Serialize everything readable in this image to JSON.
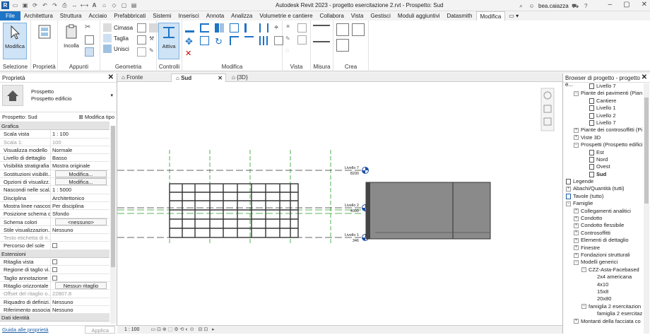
{
  "title_bar": {
    "title": "Autodesk Revit 2023 - progetto esercitazione 2.rvt - Prospetto: Sud",
    "user": "bea.caiazza"
  },
  "menu_tabs": [
    "File",
    "Architettura",
    "Struttura",
    "Acciaio",
    "Prefabbricati",
    "Sistemi",
    "Inserisci",
    "Annota",
    "Analizza",
    "Volumetrie e cantiere",
    "Collabora",
    "Vista",
    "Gestisci",
    "Moduli aggiuntivi",
    "Datasmith",
    "Modifica"
  ],
  "ribbon": {
    "modifica_label": "Modifica",
    "proprieta_label": "Proprietà",
    "incolla_label": "Incolla",
    "cimasa_label": "Cimasa",
    "taglia_label": "Taglia",
    "unisci_label": "Unisci",
    "attiva_label": "Attiva",
    "groups": {
      "selezione": "Selezione",
      "proprieta": "Proprietà",
      "appunti": "Appunti",
      "geometria": "Geometria",
      "controlli": "Controlli",
      "modifica": "Modifica",
      "vista": "Vista",
      "misura": "Misura",
      "crea": "Crea"
    }
  },
  "properties": {
    "panel_title": "Proprietà",
    "type_line1": "Prospetto",
    "type_line2": "Prospetto edificio",
    "instance_label": "Prospetto: Sud",
    "edit_type": "Modifica tipo",
    "sections": [
      {
        "name": "Grafica",
        "rows": [
          {
            "k": "Scala vista",
            "v": "1 : 100"
          },
          {
            "k": "Scala 1:",
            "v": "100",
            "grey": true
          },
          {
            "k": "Visualizza modello",
            "v": "Normale"
          },
          {
            "k": "Livello di dettaglio",
            "v": "Basso"
          },
          {
            "k": "Visibilità stratigrafia",
            "v": "Mostra originale"
          },
          {
            "k": "Sostituzioni visibilit...",
            "v": "Modifica...",
            "btn": true
          },
          {
            "k": "Opzioni di visualizz...",
            "v": "Modifica...",
            "btn": true
          },
          {
            "k": "Nascondi nelle scal...",
            "v": "1 : 5000"
          },
          {
            "k": "Disciplina",
            "v": "Architettonico"
          },
          {
            "k": "Mostra linee nascos...",
            "v": "Per disciplina"
          },
          {
            "k": "Posizione schema c...",
            "v": "Sfondo"
          },
          {
            "k": "Schema colori",
            "v": "<nessuno>",
            "btn": true
          },
          {
            "k": "Stile visualizzazion...",
            "v": "Nessuno"
          },
          {
            "k": "Testo etichetta di ri...",
            "v": "",
            "grey": true
          },
          {
            "k": "Percorso del sole",
            "v": "",
            "check": true
          }
        ]
      },
      {
        "name": "Estensioni",
        "rows": [
          {
            "k": "Ritaglia vista",
            "v": "",
            "check": true
          },
          {
            "k": "Regione di taglio vi...",
            "v": "",
            "check": true
          },
          {
            "k": "Taglio annotazione",
            "v": "",
            "check": true
          },
          {
            "k": "Ritaglio orizzontale",
            "v": "Nessun ritaglio",
            "btn": true
          },
          {
            "k": "Offset del ritaglio o...",
            "v": "22807.8",
            "grey": true
          },
          {
            "k": "Riquadro di definizi...",
            "v": "Nessuno"
          },
          {
            "k": "Riferimento associa...",
            "v": "Nessuno"
          }
        ]
      },
      {
        "name": "Dati identità",
        "rows": []
      }
    ],
    "help_link": "Guida alle proprietà",
    "apply": "Applica"
  },
  "view_tabs": [
    {
      "label": "Fronte",
      "active": false
    },
    {
      "label": "Sud",
      "active": true
    },
    {
      "label": "{3D}",
      "active": false
    }
  ],
  "levels": [
    {
      "name": "Livello 7",
      "elev": "8200"
    },
    {
      "name": "Livello 2",
      "elev": "4000"
    },
    {
      "name": "Livello 1",
      "elev": "346"
    }
  ],
  "status": {
    "scale": "1 : 100"
  },
  "browser": {
    "title": "Browser di progetto - progetto e...",
    "items": [
      {
        "label": "Livello 7",
        "indent": 3,
        "icon": "sheet"
      },
      {
        "label": "Piante dei pavimenti (Pian",
        "indent": 1,
        "icon": "minus"
      },
      {
        "label": "Cantiere",
        "indent": 3,
        "icon": "sheet"
      },
      {
        "label": "Livello 1",
        "indent": 3,
        "icon": "sheet"
      },
      {
        "label": "Livello 2",
        "indent": 3,
        "icon": "sheet"
      },
      {
        "label": "Livello 7",
        "indent": 3,
        "icon": "sheet"
      },
      {
        "label": "Piante dei controsoffitti (Pi",
        "indent": 1,
        "icon": "plus"
      },
      {
        "label": "Viste 3D",
        "indent": 1,
        "icon": "plus"
      },
      {
        "label": "Prospetti (Prospetto edifici",
        "indent": 1,
        "icon": "minus"
      },
      {
        "label": "Est",
        "indent": 3,
        "icon": "sheet"
      },
      {
        "label": "Nord",
        "indent": 3,
        "icon": "sheet"
      },
      {
        "label": "Ovest",
        "indent": 3,
        "icon": "sheet"
      },
      {
        "label": "Sud",
        "indent": 3,
        "icon": "sheet",
        "bold": true
      },
      {
        "label": "Legende",
        "indent": 0,
        "icon": "legend"
      },
      {
        "label": "Abachi/Quantità (tutti)",
        "indent": 0,
        "icon": "plus"
      },
      {
        "label": "Tavole (tutto)",
        "indent": 0,
        "icon": "sheetblue"
      },
      {
        "label": "Famiglie",
        "indent": 0,
        "icon": "minus"
      },
      {
        "label": "Collegamenti analitici",
        "indent": 1,
        "icon": "plus"
      },
      {
        "label": "Condotto",
        "indent": 1,
        "icon": "plus"
      },
      {
        "label": "Condotto flessibile",
        "indent": 1,
        "icon": "plus"
      },
      {
        "label": "Controsoffitti",
        "indent": 1,
        "icon": "plus"
      },
      {
        "label": "Elementi di dettaglio",
        "indent": 1,
        "icon": "plus"
      },
      {
        "label": "Finestre",
        "indent": 1,
        "icon": "plus"
      },
      {
        "label": "Fondazioni strutturali",
        "indent": 1,
        "icon": "plus"
      },
      {
        "label": "Modelli generici",
        "indent": 1,
        "icon": "minus"
      },
      {
        "label": "CZZ-Asta-Facebased",
        "indent": 2,
        "icon": "minus"
      },
      {
        "label": "2x4 americana",
        "indent": 4,
        "icon": "none"
      },
      {
        "label": "4x10",
        "indent": 4,
        "icon": "none"
      },
      {
        "label": "15x8",
        "indent": 4,
        "icon": "none"
      },
      {
        "label": "20x80",
        "indent": 4,
        "icon": "none"
      },
      {
        "label": "famiglia 2 esercitazion",
        "indent": 2,
        "icon": "minus"
      },
      {
        "label": "famiglia 2 esercitaz",
        "indent": 4,
        "icon": "none"
      },
      {
        "label": "Montanti della facciata co",
        "indent": 1,
        "icon": "plus"
      }
    ]
  }
}
